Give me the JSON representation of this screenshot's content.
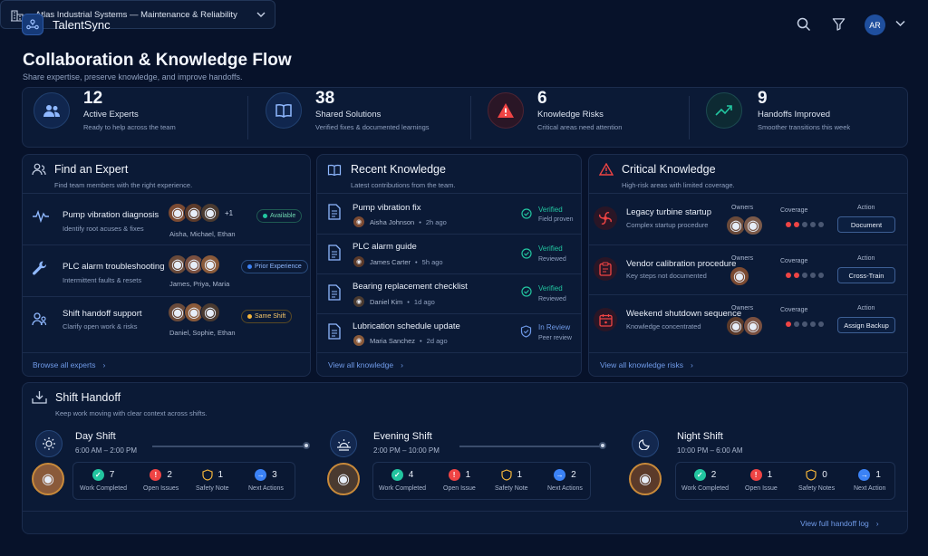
{
  "app": {
    "name": "TalentSync",
    "user_initials": "AR"
  },
  "page": {
    "title": "Collaboration & Knowledge Flow",
    "subtitle": "Share expertise, preserve knowledge, and improve handoffs."
  },
  "org_selector": {
    "value": "Atlas Industrial Systems — Maintenance & Reliability"
  },
  "stats": [
    {
      "value": "12",
      "label": "Active Experts",
      "sub": "Ready to help across the team"
    },
    {
      "value": "38",
      "label": "Shared Solutions",
      "sub": "Verified fixes & documented learnings"
    },
    {
      "value": "6",
      "label": "Knowledge Risks",
      "sub": "Critical areas need attention"
    },
    {
      "value": "9",
      "label": "Handoffs Improved",
      "sub": "Smoother transitions this week"
    }
  ],
  "experts": {
    "title": "Find an Expert",
    "subtitle": "Find team members with the right experience.",
    "items": [
      {
        "title": "Pump vibration diagnosis",
        "sub": "Identify root acuses & fixes",
        "names": "Aisha, Michael, Ethan",
        "extra": "+1",
        "badge": "Available"
      },
      {
        "title": "PLC alarm troubleshooting",
        "sub": "Intermittent faults & resets",
        "names": "James, Priya, Maria",
        "badge": "Prior Experience"
      },
      {
        "title": "Shift handoff support",
        "sub": "Clarify open work & risks",
        "names": "Daniel, Sophie, Ethan",
        "badge": "Same Shift"
      }
    ],
    "link": "Browse all experts"
  },
  "knowledge": {
    "title": "Recent Knowledge",
    "subtitle": "Latest contributions from the team.",
    "items": [
      {
        "title": "Pump vibration fix",
        "author": "Aisha Johnson",
        "time": "2h ago",
        "status": "Verified",
        "status_sub": "Field proven"
      },
      {
        "title": "PLC alarm guide",
        "author": "James Carter",
        "time": "5h ago",
        "status": "Verified",
        "status_sub": "Reviewed"
      },
      {
        "title": "Bearing replacement checklist",
        "author": "Daniel Kim",
        "time": "1d ago",
        "status": "Verified",
        "status_sub": "Reviewed"
      },
      {
        "title": "Lubrication schedule update",
        "author": "Maria Sanchez",
        "time": "2d ago",
        "status": "In Review",
        "status_sub": "Peer review"
      }
    ],
    "link": "View all knowledge"
  },
  "critical": {
    "title": "Critical Knowledge",
    "subtitle": "High-risk areas with limited coverage.",
    "col_owners": "Owners",
    "col_coverage": "Coverage",
    "col_action": "Action",
    "items": [
      {
        "title": "Legacy turbine startup",
        "sub": "Complex startup procedure",
        "coverage": 2,
        "action": "Document"
      },
      {
        "title": "Vendor calibration procedure",
        "sub": "Key steps not documented",
        "coverage": 2,
        "action": "Cross-Train"
      },
      {
        "title": "Weekend shutdown sequence",
        "sub": "Knowledge concentrated",
        "coverage": 1,
        "action": "Assign Backup"
      }
    ],
    "link": "View all knowledge risks"
  },
  "handoff": {
    "title": "Shift Handoff",
    "subtitle": "Keep work moving with clear context across shifts.",
    "shifts": [
      {
        "name": "Day Shift",
        "time": "6:00 AM – 2:00 PM",
        "metrics": [
          {
            "v": "7",
            "l": "Work Completed"
          },
          {
            "v": "2",
            "l": "Open Issues"
          },
          {
            "v": "1",
            "l": "Safety Note"
          },
          {
            "v": "3",
            "l": "Next Actions"
          }
        ]
      },
      {
        "name": "Evening Shift",
        "time": "2:00 PM – 10:00 PM",
        "metrics": [
          {
            "v": "4",
            "l": "Work Completed"
          },
          {
            "v": "1",
            "l": "Open Issue"
          },
          {
            "v": "1",
            "l": "Safety Note"
          },
          {
            "v": "2",
            "l": "Next Actions"
          }
        ]
      },
      {
        "name": "Night Shift",
        "time": "10:00 PM – 6:00 AM",
        "metrics": [
          {
            "v": "2",
            "l": "Work Completed"
          },
          {
            "v": "1",
            "l": "Open Issue"
          },
          {
            "v": "0",
            "l": "Safety Notes"
          },
          {
            "v": "1",
            "l": "Next Action"
          }
        ]
      }
    ],
    "link": "View full handoff log"
  },
  "colors": {
    "accent": "#3b82f6",
    "success": "#22c5a0",
    "danger": "#ef4444",
    "warning": "#f5b63b"
  }
}
